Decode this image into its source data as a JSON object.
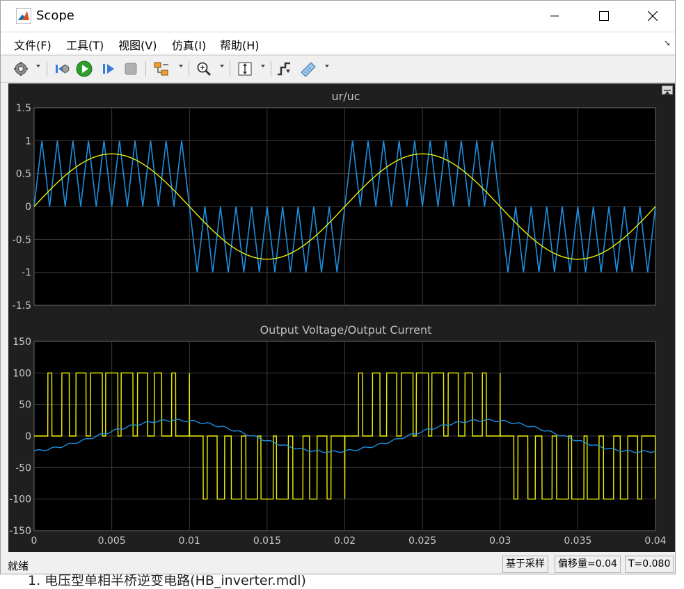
{
  "window": {
    "title": "Scope",
    "controls": {
      "minimize": "—",
      "maximize": "☐",
      "close": "✕"
    }
  },
  "menu": {
    "items": [
      "文件(F)",
      "工具(T)",
      "视图(V)",
      "仿真(I)",
      "帮助(H)"
    ]
  },
  "toolbar": {
    "buttons": [
      "settings-icon",
      "step-back-icon",
      "run-icon",
      "step-forward-icon",
      "stop-icon",
      "highlight-icon",
      "zoom-icon",
      "autoscale-icon",
      "triggers-icon",
      "measurements-icon"
    ]
  },
  "status": {
    "left": "就绪",
    "mode": "基于采样",
    "offset": "偏移量=0.04",
    "time": "T=0.080"
  },
  "background_text": "1.  电压型单相半桥逆变电路(HB_inverter.mdl)",
  "chart_data": [
    {
      "type": "line",
      "title": "ur/uc",
      "xlim": [
        0,
        0.04
      ],
      "ylim": [
        -1.5,
        1.5
      ],
      "yticks": [
        "1.5",
        "1",
        "0.5",
        "0",
        "-0.5",
        "-1",
        "-1.5"
      ],
      "grid": true,
      "series": [
        {
          "color": "#1f8fe0",
          "shape": "half-rectified triangle carrier, amplitude 1, 20 cycles per 0.02 s",
          "carrier_freq_hz": 1000,
          "amplitude": 1
        },
        {
          "color": "#f0f000",
          "shape": "sine",
          "freq_hz": 50,
          "amplitude": 0.8
        }
      ]
    },
    {
      "type": "line",
      "title": "Output Voltage/Output Current",
      "xlim": [
        0,
        0.04
      ],
      "ylim": [
        -150,
        150
      ],
      "xticks": [
        "0",
        "0.005",
        "0.01",
        "0.015",
        "0.02",
        "0.025",
        "0.03",
        "0.035",
        "0.04"
      ],
      "yticks": [
        "150",
        "100",
        "50",
        "0",
        "-50",
        "-100",
        "-150"
      ],
      "grid": true,
      "series": [
        {
          "color": "#f0f000",
          "shape": "PWM pulses 0/±100",
          "amplitude": 100
        },
        {
          "color": "#1f8fe0",
          "shape": "sine-like current",
          "amplitude": 25,
          "freq_hz": 50
        }
      ]
    }
  ]
}
